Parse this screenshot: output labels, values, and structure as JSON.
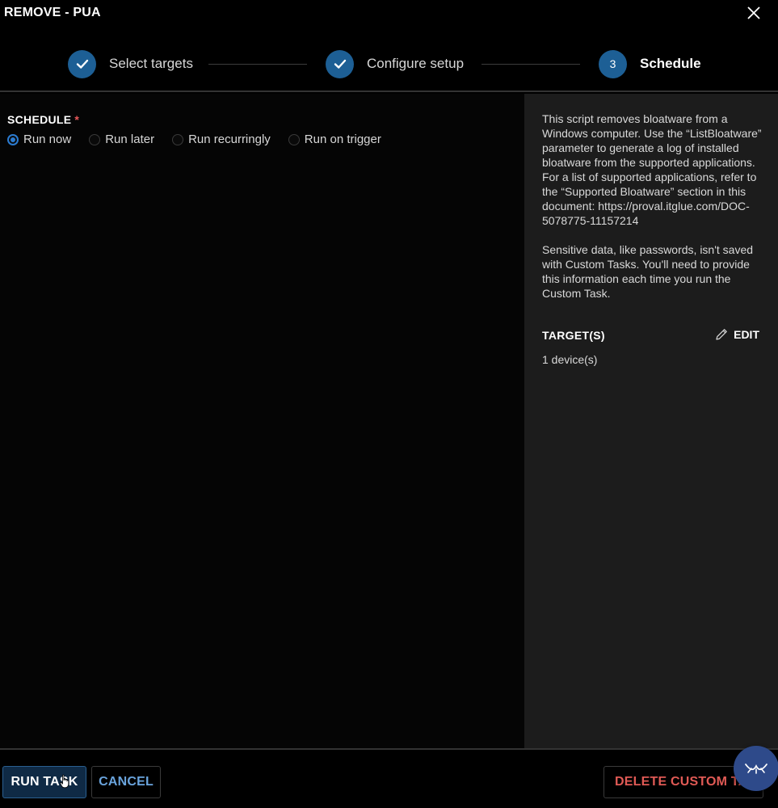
{
  "window": {
    "title": "REMOVE - PUA",
    "close_icon": "close-icon"
  },
  "stepper": {
    "steps": [
      {
        "label": "Select targets",
        "state": "complete",
        "marker": "check-icon"
      },
      {
        "label": "Configure setup",
        "state": "complete",
        "marker": "check-icon"
      },
      {
        "label": "Schedule",
        "state": "active",
        "number": "3"
      }
    ]
  },
  "schedule": {
    "label": "SCHEDULE",
    "required_mark": "*",
    "options": [
      {
        "label": "Run now",
        "selected": true
      },
      {
        "label": "Run later",
        "selected": false
      },
      {
        "label": "Run recurringly",
        "selected": false
      },
      {
        "label": "Run on trigger",
        "selected": false
      }
    ]
  },
  "sidepanel": {
    "description": "This script removes bloatware from a Windows computer. Use the “ListBloatware” parameter to generate a log of installed bloatware from the supported applications. For a list of supported applications, refer to the “Supported Bloatware” section in this document: https://proval.itglue.com/DOC-5078775-11157214",
    "note": "Sensitive data, like passwords, isn't saved with Custom Tasks. You'll need to provide this information each time you run the Custom Task.",
    "targets_title": "TARGET(S)",
    "edit_label": "EDIT",
    "edit_icon": "pencil-icon",
    "device_count": "1 device(s)"
  },
  "footer": {
    "run_label": "RUN TASK",
    "cancel_label": "CANCEL",
    "delete_label": "DELETE CUSTOM TASK"
  },
  "colors": {
    "accent": "#1d5f95",
    "radio_selected": "#2b7bd0",
    "danger": "#e05a55",
    "link": "#6aa4dd",
    "panel": "#1c1c1c",
    "fab": "#2e4a8a"
  }
}
